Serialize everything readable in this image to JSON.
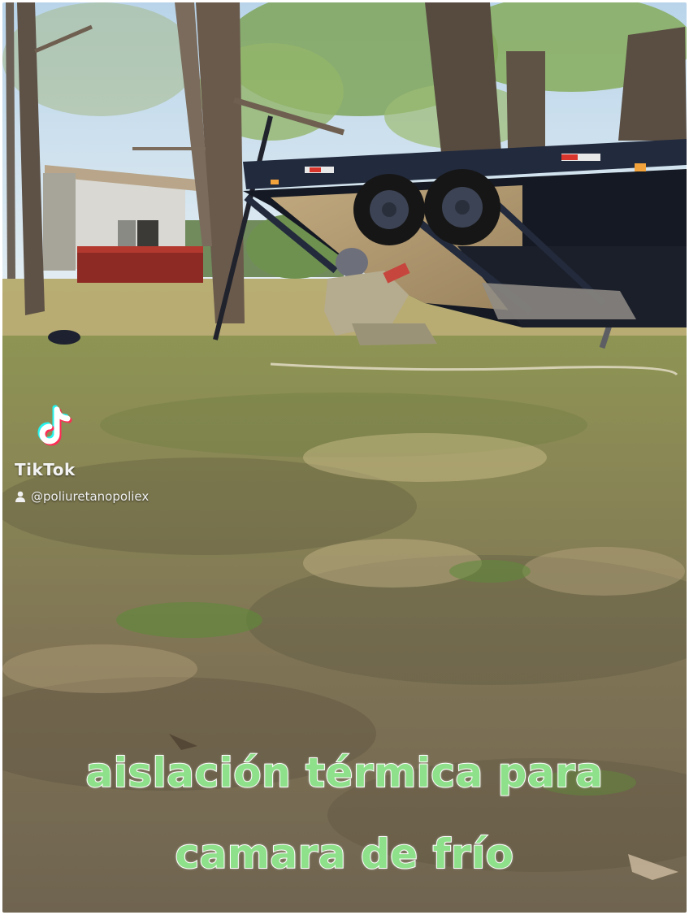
{
  "watermark": {
    "brand": "TikTok",
    "handle": "@poliuretanopoliex",
    "logo_icon": "tiktok-note-icon",
    "user_icon": "user-icon"
  },
  "caption": {
    "line1": "aislación térmica para",
    "line2": "camara de frío"
  },
  "colors": {
    "caption_fill": "#8fe08a",
    "caption_stroke": "#ffffff",
    "tiktok_cyan": "#25f4ee",
    "tiktok_red": "#fe2c55",
    "trailer": "#1d2233"
  }
}
